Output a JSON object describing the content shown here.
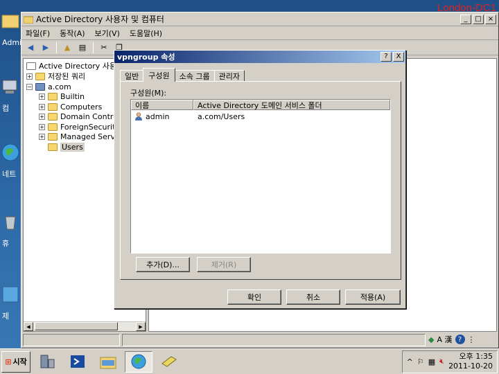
{
  "machine_name": "London-DC1",
  "desktop": {
    "icons": [
      {
        "label": "Admi"
      },
      {
        "label": "컴"
      },
      {
        "label": "네트"
      },
      {
        "label": "휴"
      },
      {
        "label": "제"
      }
    ]
  },
  "main_window": {
    "title": "Active Directory 사용자 및 컴퓨터",
    "menu": [
      "파일(F)",
      "동작(A)",
      "보기(V)",
      "도움말(H)"
    ],
    "tree": {
      "root": "Active Directory 사용자",
      "saved_queries": "저장된 쿼리",
      "domain": "a.com",
      "children": [
        "Builtin",
        "Computers",
        "Domain Contro",
        "ForeignSecurit",
        "Managed Serv",
        "Users"
      ]
    }
  },
  "dialog": {
    "title": "vpngroup 속성",
    "help": "?",
    "close": "X",
    "tabs": [
      "일반",
      "구성원",
      "소속 그룹",
      "관리자"
    ],
    "active_tab": "구성원",
    "members_label": "구성원(M):",
    "columns": [
      "이름",
      "Active Directory 도메인 서비스 폴더"
    ],
    "rows": [
      {
        "name": "admin",
        "folder": "a.com/Users"
      }
    ],
    "add_button": "추가(D)...",
    "remove_button": "제거(R)",
    "ok_button": "확인",
    "cancel_button": "취소",
    "apply_button": "적용(A)"
  },
  "taskbar": {
    "start_label": "시작",
    "clock_time": "오후 1:35",
    "clock_date": "2011-10-20",
    "lang_label": "A 漢"
  }
}
